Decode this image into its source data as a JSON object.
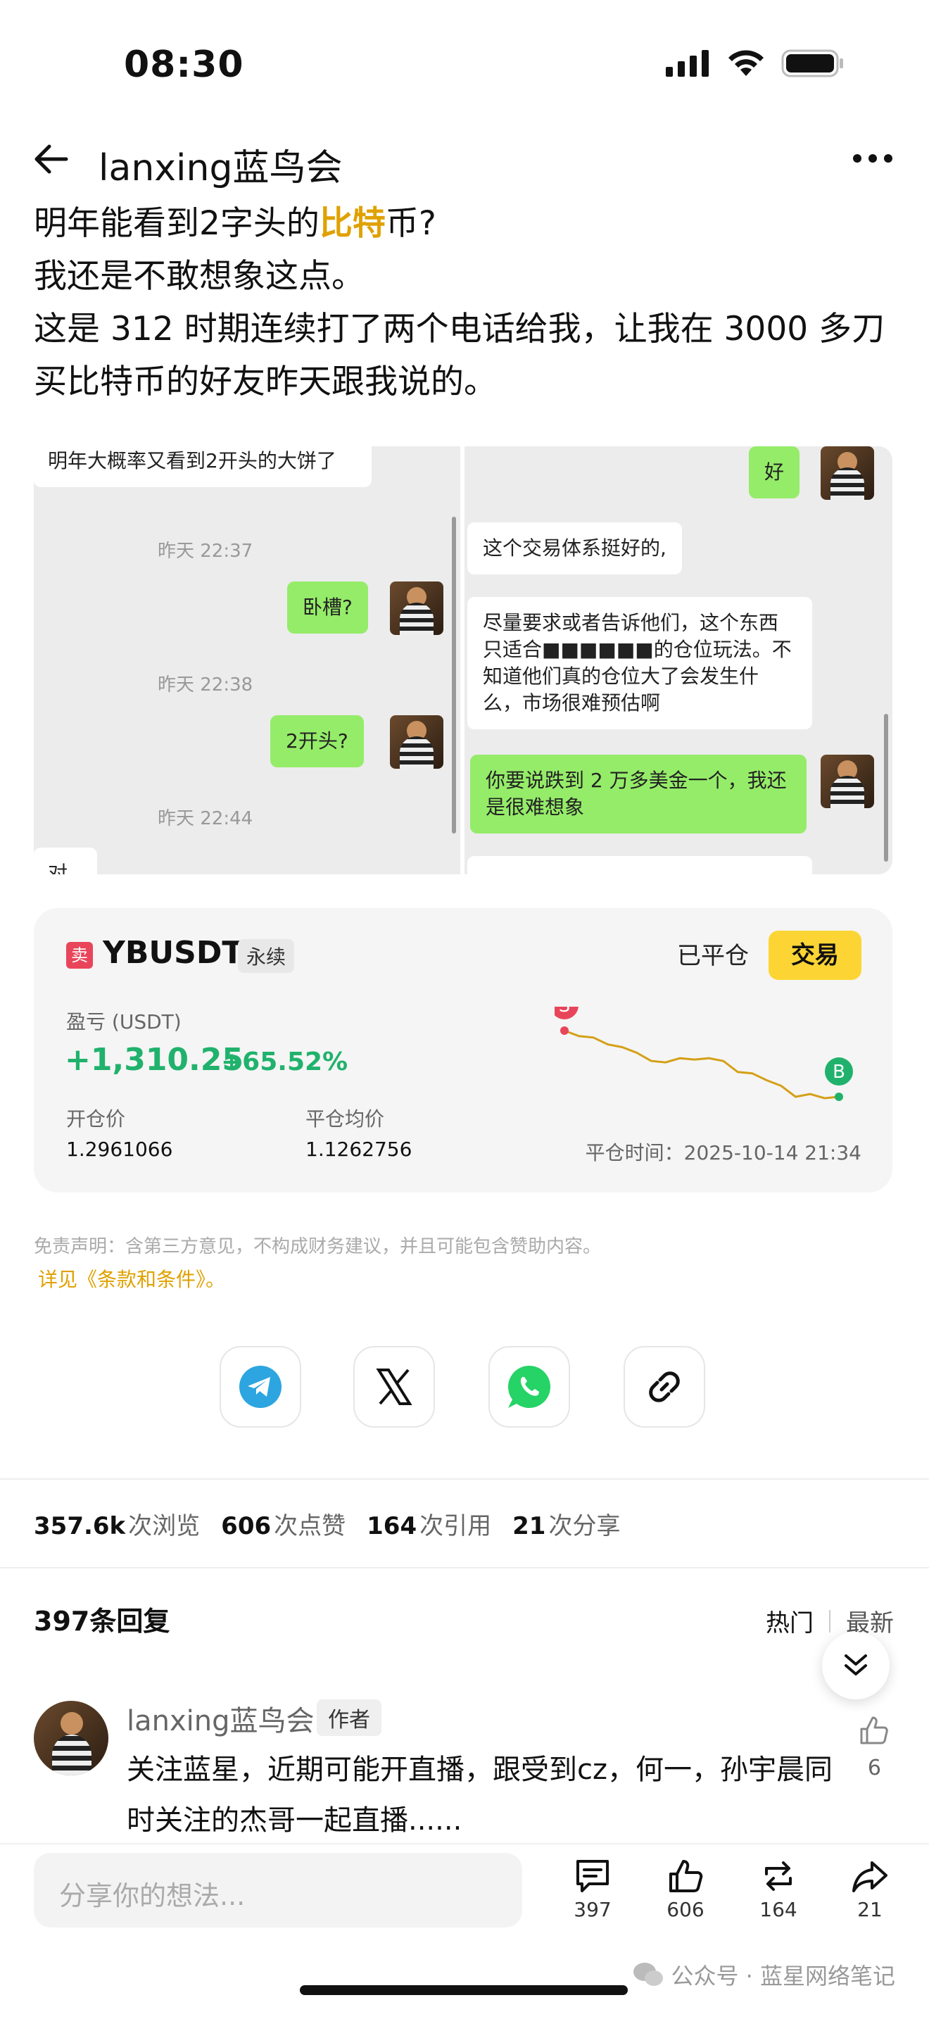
{
  "status": {
    "time": "08:30"
  },
  "header": {
    "author": "lanxing蓝鸟会"
  },
  "post": {
    "line1_pre": "明年能看到2字头的",
    "line1_highlight": "比特",
    "line1_post": "币?",
    "line2": "我还是不敢想象这点。",
    "line3": "这是 312 时期连续打了两个电话给我，让我在 3000 多刀买比特币的好友昨天跟我说的。"
  },
  "chat_left": {
    "top_partial": "明年大概率又看到2开头的大饼了",
    "ts1": "昨天 22:37",
    "msg1": "卧槽?",
    "ts2": "昨天 22:38",
    "msg2": "2开头?",
    "ts3": "昨天 22:44",
    "bottom_partial": "对"
  },
  "chat_right": {
    "msg_ok": "好",
    "msg1": "这个交易体系挺好的,",
    "msg2": "尽量要求或者告诉他们，这个东西只适合■■■■■■的仓位玩法。不知道他们真的仓位大了会发生什么，市场很难预估啊",
    "msg3": "你要说跌到 2 万多美金一个，我还是很难想象"
  },
  "trade": {
    "side": "卖",
    "symbol": "YBUSDT",
    "type": "永续",
    "status": "已平仓",
    "button": "交易",
    "pnl_label": "盈亏 (USDT)",
    "pnl": "+1,310.25",
    "pnl_pct": "+65.52%",
    "open_label": "开仓价",
    "open_value": "1.2961066",
    "avg_label": "平仓均价",
    "avg_value": "1.1262756",
    "close_time": "平仓时间：2025-10-14 21:34",
    "markers": {
      "sell": "S",
      "buy": "B"
    },
    "colors": {
      "profit": "#20b26c",
      "line": "#d4a017",
      "sell": "#e9455a",
      "buy": "#20b26c"
    },
    "price_series": [
      100,
      98,
      97.5,
      95,
      94,
      92,
      89,
      88.5,
      90,
      89.5,
      90,
      89,
      85,
      84.5,
      82,
      80,
      76,
      77,
      75.5,
      76
    ]
  },
  "disclaimer": {
    "text": "免责声明：含第三方意见，不构成财务建议，并且可能包含赞助内容。",
    "terms": "详见《条款和条件》。"
  },
  "share_icons": [
    "telegram-icon",
    "x-icon",
    "whatsapp-icon",
    "link-icon"
  ],
  "stats": {
    "views": "357.6k",
    "views_label": "次浏览",
    "likes": "606",
    "likes_label": "次点赞",
    "quotes": "164",
    "quotes_label": "次引用",
    "shares": "21",
    "shares_label": "次分享"
  },
  "replies": {
    "title": "397条回复",
    "sort_hot": "热门",
    "sort_new": "最新"
  },
  "comment": {
    "name": "lanxing蓝鸟会",
    "badge": "作者",
    "text": "关注蓝星，近期可能开直播，跟受到cz，何一，孙宇晨同时关注的杰哥一起直播......",
    "likes": "6"
  },
  "bottom": {
    "placeholder": "分享你的想法...",
    "comments": "397",
    "likes": "606",
    "reposts": "164",
    "shares": "21",
    "watermark": "公众号 · 蓝星网络笔记"
  }
}
